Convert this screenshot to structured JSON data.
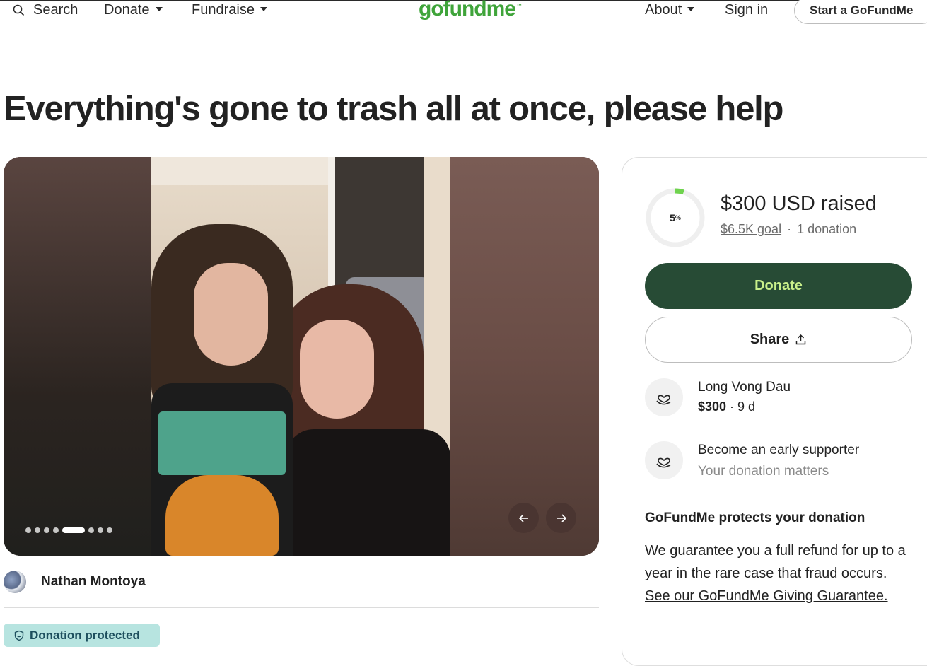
{
  "nav": {
    "search_label": "Search",
    "donate_label": "Donate",
    "fundraise_label": "Fundraise",
    "logo_text": "gofundme",
    "logo_mark": "™",
    "about_label": "About",
    "signin_label": "Sign in",
    "start_label": "Start a GoFundMe"
  },
  "campaign": {
    "title": "Everything's gone to trash all at once, please help",
    "organizer_name": "Nathan Montoya",
    "protected_badge": "Donation protected"
  },
  "gallery": {
    "total_images": 8,
    "active_index": 4,
    "prev_icon": "arrow-left-icon",
    "next_icon": "arrow-right-icon"
  },
  "progress": {
    "percent_number": "5",
    "percent_symbol": "%",
    "percent_value": 0.05,
    "raised_text": "$300 USD raised",
    "goal_text": "$6.5K goal",
    "separator": "·",
    "donations_text": "1 donation"
  },
  "actions": {
    "donate_label": "Donate",
    "share_label": "Share"
  },
  "supporters": [
    {
      "name": "Long Vong Dau",
      "amount": "$300",
      "meta_sep": " · ",
      "time": "9 d"
    },
    {
      "name": "Become an early supporter",
      "subtitle": "Your donation matters"
    }
  ],
  "protection": {
    "title": "GoFundMe protects your donation",
    "body": "We guarantee you a full refund for up to a year in the rare case that fraud occurs. ",
    "link_text": "See our GoFundMe Giving Guarantee."
  },
  "colors": {
    "brand_green": "#3fa43a",
    "donate_bg": "#274b35",
    "donate_text": "#c9f08a",
    "badge_bg": "#b7e4e0",
    "progress_green": "#6fd34e"
  }
}
